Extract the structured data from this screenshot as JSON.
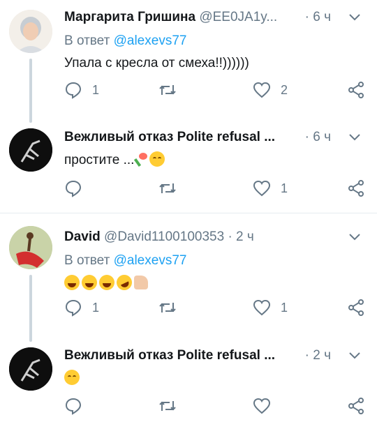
{
  "tweets": [
    {
      "name": "Маргарита Гришина",
      "handle": "@EE0JA1y...",
      "dot": "·",
      "time": "6 ч",
      "reply_prefix": "В ответ",
      "reply_to": "@alexevs77",
      "text": "Упала с кресла от смеха!!))))))",
      "counts": {
        "reply": "1",
        "retweet": "",
        "like": "2"
      }
    },
    {
      "name": "Вежливый отказ Polite refusal ...",
      "handle": "",
      "dot": "·",
      "time": "6 ч",
      "text": "простите ...",
      "emojis": [
        "bouquet",
        "smiling-face-with-smiling-eyes"
      ],
      "counts": {
        "reply": "",
        "retweet": "",
        "like": "1"
      }
    },
    {
      "name": "David",
      "handle": "@David1100100353",
      "dot": "·",
      "time": "2 ч",
      "reply_prefix": "В ответ",
      "reply_to": "@alexevs77",
      "emojis": [
        "grinning-squinting-face",
        "grinning-squinting-face",
        "grinning-squinting-face",
        "rolling-on-floor-laughing",
        "thumbs-up"
      ],
      "counts": {
        "reply": "1",
        "retweet": "",
        "like": "1"
      }
    },
    {
      "name": "Вежливый отказ Polite refusal ...",
      "handle": "",
      "dot": "·",
      "time": "2 ч",
      "emojis": [
        "smiling-face-with-smiling-eyes"
      ],
      "counts": {
        "reply": "",
        "retweet": "",
        "like": ""
      }
    }
  ],
  "colors": {
    "link": "#1da1f2",
    "muted": "#657786",
    "text": "#14171a",
    "thread": "#ccd6dd"
  },
  "icons": [
    "reply-icon",
    "retweet-icon",
    "like-icon",
    "share-icon",
    "chevron-down-icon"
  ]
}
